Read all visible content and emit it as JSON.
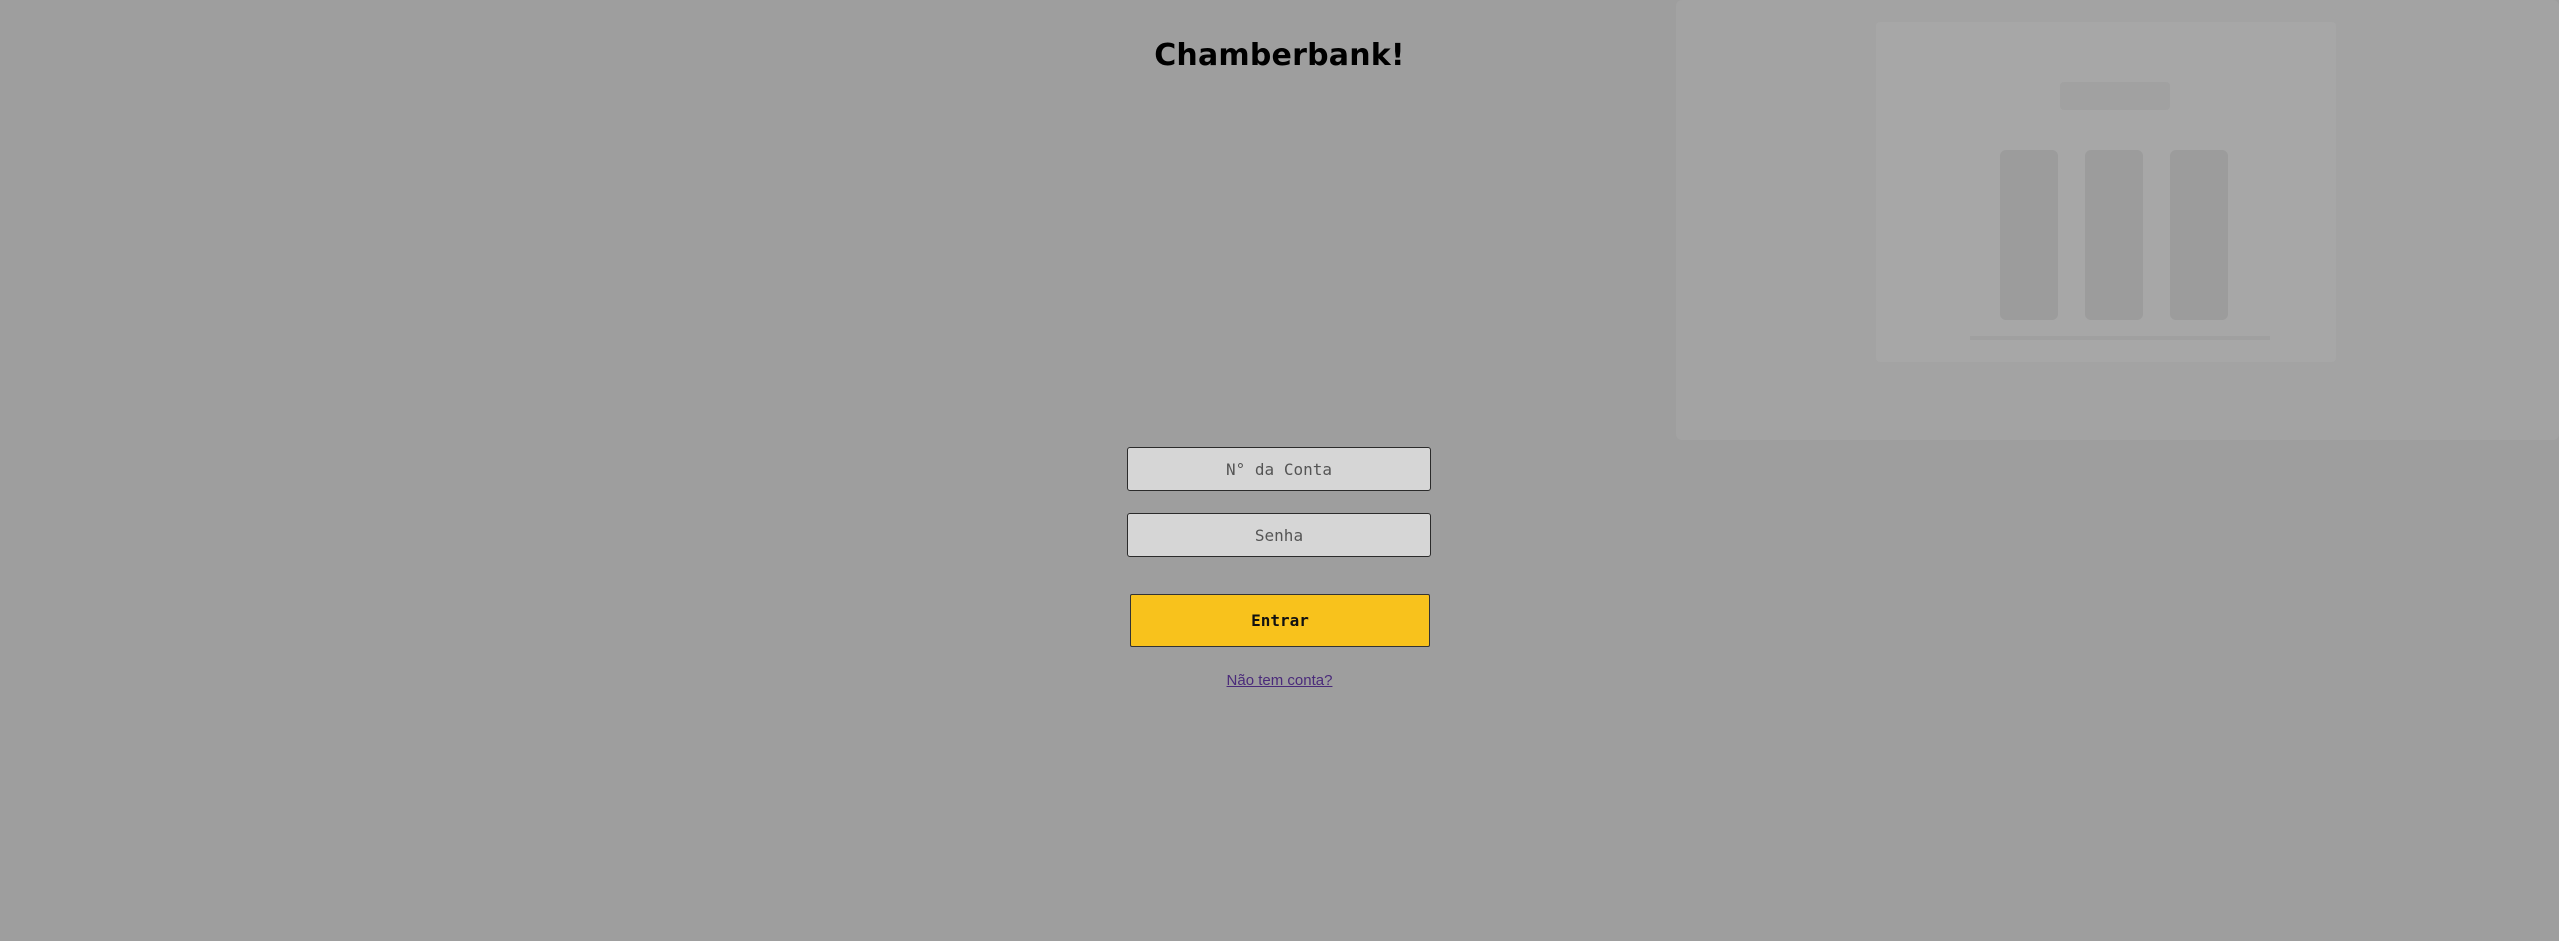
{
  "app": {
    "title": "Chamberbank!"
  },
  "login": {
    "account_placeholder": "N° da Conta",
    "password_placeholder": "Senha",
    "submit_label": "Entrar",
    "signup_link": "Não tem conta?"
  },
  "colors": {
    "background": "#9e9e9e",
    "button": "#f8c21c",
    "input": "#d6d6d6",
    "link": "#4a2a7a"
  }
}
